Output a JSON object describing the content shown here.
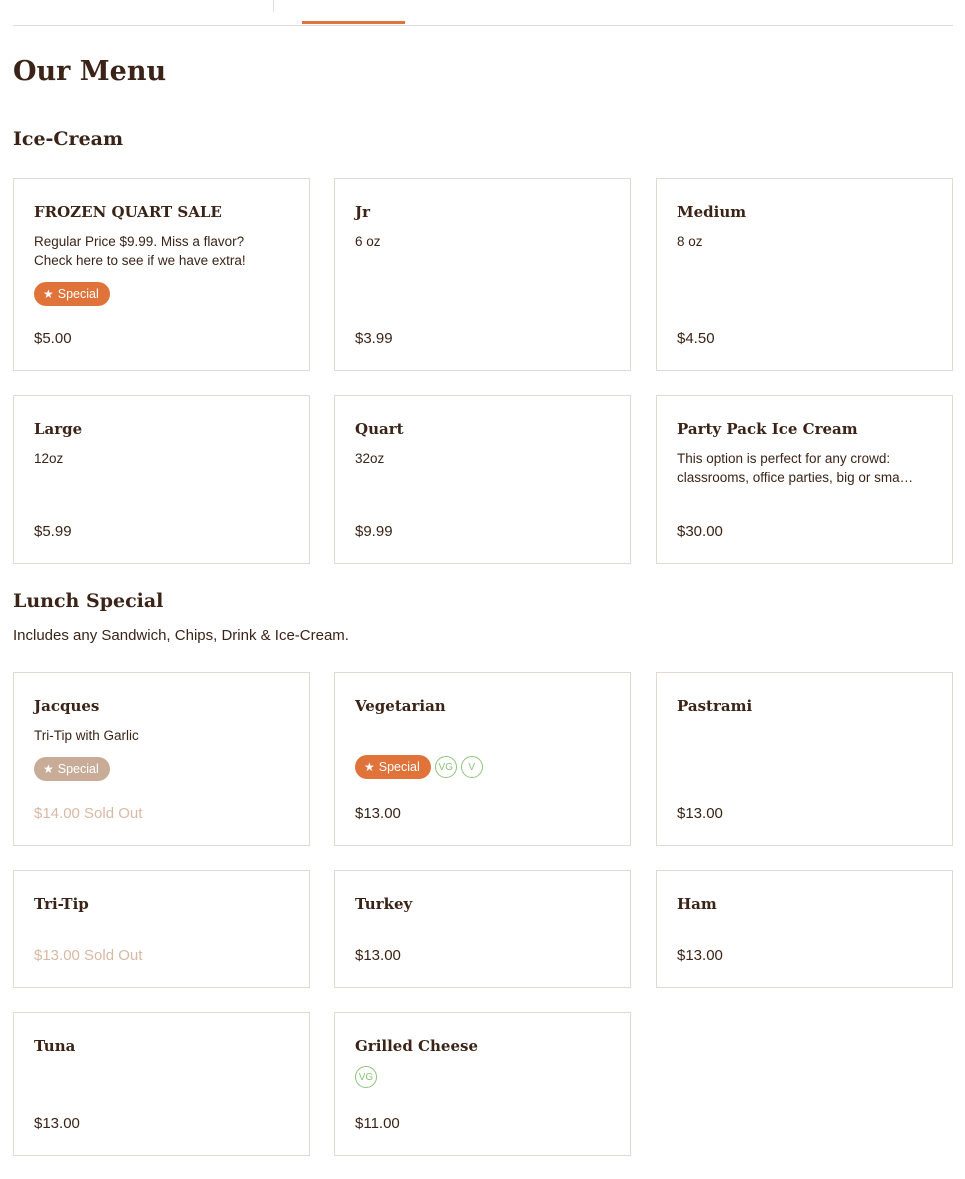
{
  "menu": {
    "title": "Our Menu"
  },
  "sections": {
    "icecream": {
      "title": "Ice-Cream",
      "items": [
        {
          "name": "FROZEN QUART SALE",
          "desc1": "Regular Price $9.99. Miss a flavor?",
          "desc2": "Check here to see if we have extra!",
          "badge": "Special",
          "price": "$5.00"
        },
        {
          "name": "Jr",
          "desc1": "6 oz",
          "price": "$3.99"
        },
        {
          "name": "Medium",
          "desc1": "8 oz",
          "price": "$4.50"
        },
        {
          "name": "Large",
          "desc1": "12oz",
          "price": "$5.99"
        },
        {
          "name": "Quart",
          "desc1": "32oz",
          "price": "$9.99"
        },
        {
          "name": "Party Pack Ice Cream",
          "desc1": "This option is perfect for any crowd:",
          "desc2": "classrooms, office parties, big or sma…",
          "price": "$30.00"
        }
      ]
    },
    "lunch": {
      "title": "Lunch Special",
      "description": "Includes any Sandwich, Chips, Drink & Ice-Cream.",
      "items": [
        {
          "name": "Jacques",
          "desc1": "Tri-Tip with Garlic",
          "badge": "Special",
          "price": "$14.00 Sold Out"
        },
        {
          "name": "Vegetarian",
          "badge": "Special",
          "diet1": "VG",
          "diet2": "V",
          "price": "$13.00"
        },
        {
          "name": "Pastrami",
          "price": "$13.00"
        },
        {
          "name": "Tri-Tip",
          "price": "$13.00 Sold Out"
        },
        {
          "name": "Turkey",
          "price": "$13.00"
        },
        {
          "name": "Ham",
          "price": "$13.00"
        },
        {
          "name": "Tuna",
          "price": "$13.00"
        },
        {
          "name": "Grilled Cheese",
          "diet1": "VG",
          "price": "$11.00"
        }
      ]
    }
  },
  "colors": {
    "accent": "#e0733a",
    "text": "#3b2417",
    "border": "#e2d9d2",
    "soldout": "#d8b9a4",
    "diet": "#8cc47a"
  },
  "icons": {
    "special": "star-icon"
  }
}
